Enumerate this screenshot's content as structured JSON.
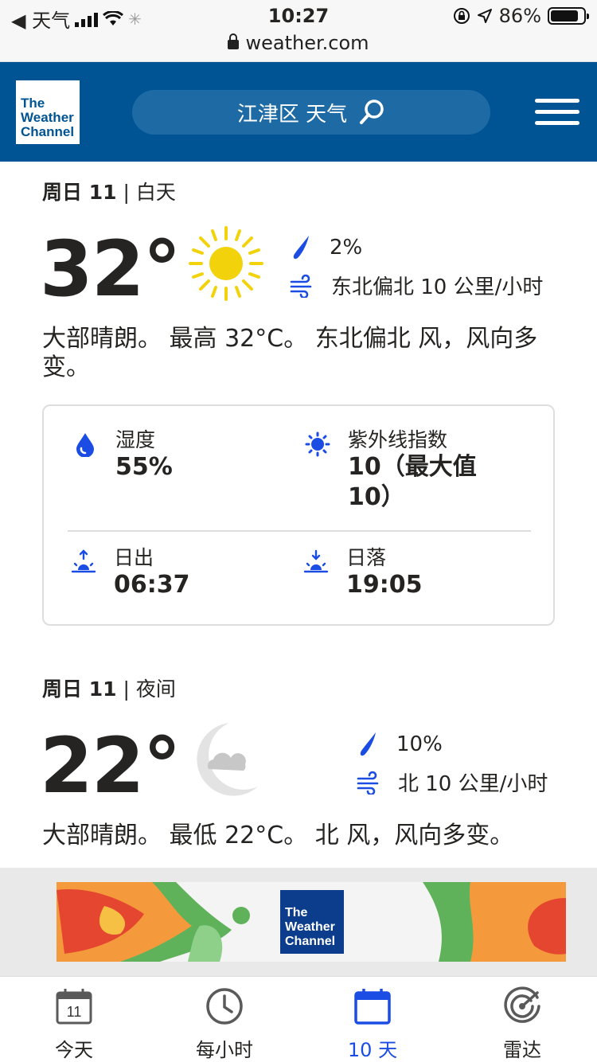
{
  "status_bar": {
    "back_app": "◀ 天气",
    "time": "10:27",
    "battery": "86%",
    "battery_fraction": 0.86,
    "url": "weather.com"
  },
  "header": {
    "logo_text": [
      "The",
      "Weather",
      "Channel"
    ],
    "search_text": "江津区 天气",
    "icons": {
      "search": "search-icon",
      "menu": "hamburger-menu-icon"
    }
  },
  "day": {
    "label_day": "周日 11",
    "label_sep": " | ",
    "label_part": "白天",
    "temp": "32°",
    "precip": "2%",
    "wind": "东北偏北 10 公里/小时",
    "description": "大部晴朗。 最高 32°C。 东北偏北 风，风向多变。"
  },
  "details": {
    "humidity_label": "湿度",
    "humidity_value": "55%",
    "uv_label": "紫外线指数",
    "uv_value": "10（最大值10）",
    "sunrise_label": "日出",
    "sunrise_value": "06:37",
    "sunset_label": "日落",
    "sunset_value": "19:05"
  },
  "night": {
    "label_day": "周日 11",
    "label_sep": " | ",
    "label_part": "夜间",
    "temp": "22°",
    "precip": "10%",
    "wind": "北 10 公里/小时",
    "description": "大部晴朗。 最低 22°C。 北 风，风向多变。"
  },
  "ad": {
    "logo_text": [
      "The",
      "Weather",
      "Channel"
    ]
  },
  "tabs": [
    {
      "label": "今天",
      "icon": "calendar-day-icon",
      "badge": "11",
      "active": false
    },
    {
      "label": "每小时",
      "icon": "clock-icon",
      "active": false
    },
    {
      "label": "10 天",
      "icon": "calendar-icon",
      "active": true
    },
    {
      "label": "雷达",
      "icon": "radar-icon",
      "active": false
    }
  ],
  "colors": {
    "header_bg": "#005493",
    "search_bg": "#1d6aa5",
    "accent_blue": "#1b4de4",
    "sun_yellow": "#f2d30b",
    "moon_gray": "#e3e3e3"
  }
}
